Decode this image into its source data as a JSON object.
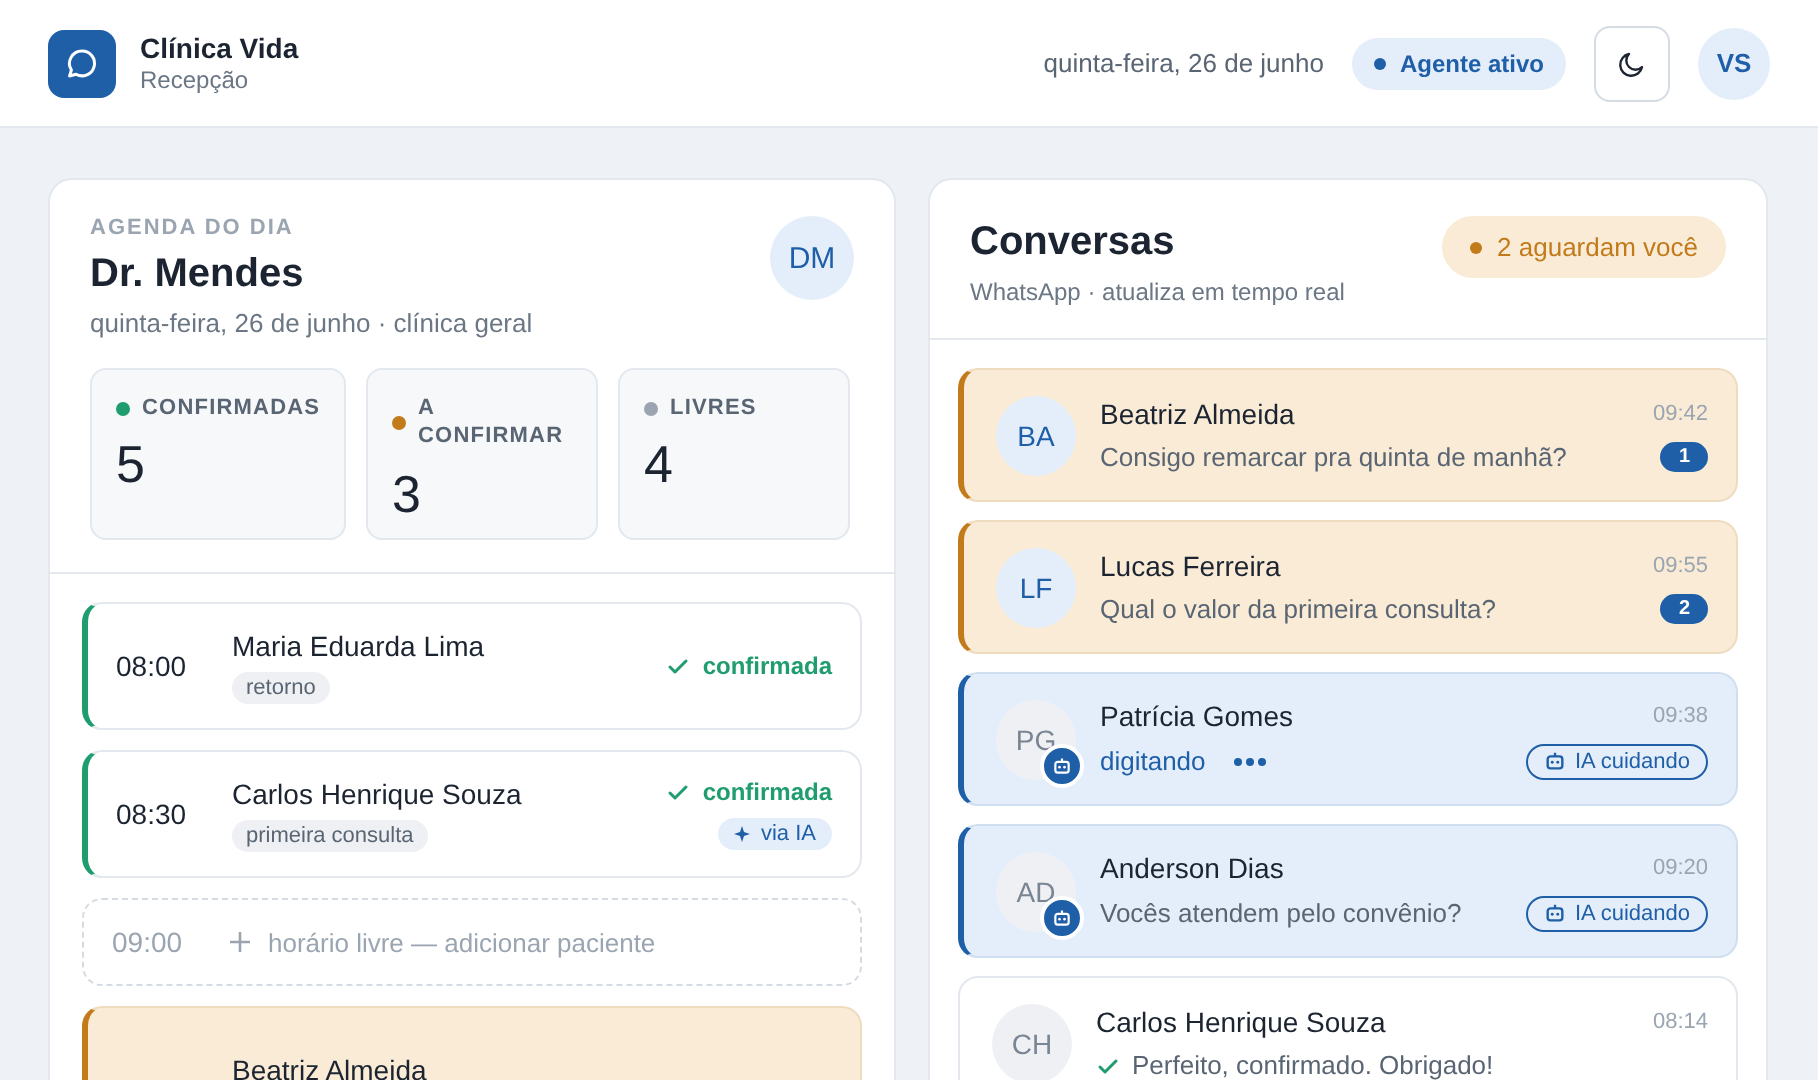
{
  "header": {
    "app_name": "Clínica Vida",
    "subtitle": "Recepção",
    "date": "quinta-feira, 26 de junho",
    "agent_status": {
      "label": "Agente ativo",
      "on": true
    },
    "user_initials": "VS"
  },
  "agenda": {
    "eyebrow": "AGENDA DO DIA",
    "doctor": "Dr. Mendes",
    "details": "quinta-feira, 26 de junho · clínica geral",
    "doctor_initials": "DM",
    "stats": [
      {
        "label": "CONFIRMADAS",
        "value": "5",
        "color": "#1f9d6e"
      },
      {
        "label": "A CONFIRMAR",
        "value": "3",
        "color": "#c27a1a"
      },
      {
        "label": "LIVRES",
        "value": "4",
        "color": "#9aa5b1"
      }
    ],
    "appointments": [
      {
        "kind": "confirmed",
        "time": "08:00",
        "patient": "Maria Eduarda Lima",
        "tag": "retorno",
        "status": "confirmada"
      },
      {
        "kind": "confirmed",
        "time": "08:30",
        "patient": "Carlos Henrique Souza",
        "tag": "primeira consulta",
        "status": "confirmada",
        "source": "via IA"
      },
      {
        "kind": "free",
        "time": "09:00",
        "action": "horário livre — adicionar paciente"
      },
      {
        "kind": "pending",
        "patient": "Beatriz Almeida"
      }
    ]
  },
  "conversations": {
    "title": "Conversas",
    "subtitle": "WhatsApp · atualiza em tempo real",
    "waiting_badge": "2 aguardam você",
    "items": [
      {
        "kind": "waiting",
        "initials": "BA",
        "name": "Beatriz Almeida",
        "time": "09:42",
        "preview": "Consigo remarcar pra quinta de manhã?",
        "typing": false,
        "unread": "1"
      },
      {
        "kind": "waiting",
        "initials": "LF",
        "name": "Lucas Ferreira",
        "time": "09:55",
        "preview": "Qual o valor da primeira consulta?",
        "typing": false,
        "unread": "2"
      },
      {
        "kind": "ai",
        "initials": "PG",
        "name": "Patrícia Gomes",
        "time": "09:38",
        "preview": "digitando",
        "typing": true,
        "tag": "IA cuidando"
      },
      {
        "kind": "ai",
        "initials": "AD",
        "name": "Anderson Dias",
        "time": "09:20",
        "preview": "Vocês atendem pelo convênio?",
        "typing": false,
        "tag": "IA cuidando"
      },
      {
        "kind": "done",
        "initials": "CH",
        "name": "Carlos Henrique Souza",
        "time": "08:14",
        "preview": "Perfeito, confirmado. Obrigado!",
        "typing": false
      }
    ]
  }
}
